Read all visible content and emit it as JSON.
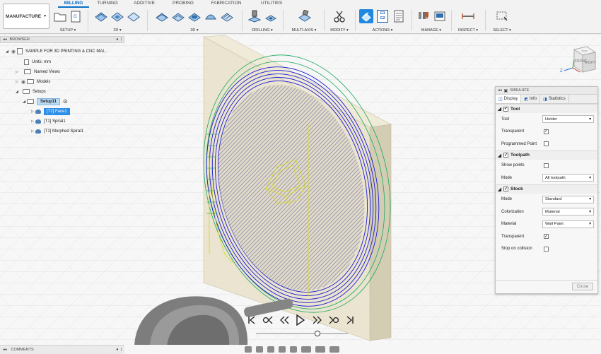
{
  "workspace": {
    "label": "MANUFACTURE"
  },
  "tabs": [
    {
      "label": "MILLING",
      "active": true
    },
    {
      "label": "TURNING"
    },
    {
      "label": "ADDITIVE"
    },
    {
      "label": "PROBING"
    },
    {
      "label": "FABRICATION"
    },
    {
      "label": "UTILITIES"
    }
  ],
  "groups": {
    "setup": "SETUP",
    "d2": "2D",
    "d3": "3D",
    "drilling": "DRILLING",
    "multiaxis": "MULTI-AXIS",
    "modify": "MODIFY",
    "actions": "ACTIONS",
    "manage": "MANAGE",
    "inspect": "INSPECT",
    "select": "SELECT"
  },
  "actions_icon_text": {
    "line1": "G1",
    "line2": "G2"
  },
  "browser": {
    "title": "BROWSER",
    "document": "SAMPLE FOR 3D PRINTING & CNC MAI...",
    "units": "Units: mm",
    "named_views": "Named Views",
    "models": "Models",
    "setups": "Setups",
    "setup_name": "Setup11",
    "operations": [
      "[T2] Face1",
      "[T1] Spiral1",
      "[T1] Morphed Spiral1"
    ]
  },
  "simulate": {
    "title": "SIMULATE",
    "tabs": [
      "Display",
      "Info",
      "Statistics"
    ],
    "tool_section": {
      "title": "Tool",
      "enabled": true,
      "tool_label": "Tool",
      "tool_value": "Holder",
      "transparent_label": "Transparent",
      "transparent_checked": true,
      "programmed_point_label": "Programmed Point",
      "programmed_point_checked": false
    },
    "toolpath_section": {
      "title": "Toolpath",
      "enabled": true,
      "show_points_label": "Show points",
      "show_points_checked": false,
      "mode_label": "Mode",
      "mode_value": "All toolpath"
    },
    "stock_section": {
      "title": "Stock",
      "enabled": true,
      "mode_label": "Mode",
      "mode_value": "Standard",
      "colorization_label": "Colorization",
      "colorization_value": "Material",
      "material_label": "Material",
      "material_value": "Wall Paint",
      "transparent_label": "Transparent",
      "transparent_checked": true,
      "stop_on_collision_label": "Stop on collision",
      "stop_on_collision_checked": false
    },
    "close_label": "Close"
  },
  "viewcube": {
    "front": "FRONT",
    "right": "RIGHT",
    "top": "TOP"
  },
  "comments": {
    "title": "COMMENTS"
  },
  "playback": {
    "progress": 0.68
  },
  "colors": {
    "accent": "#0a6ec8",
    "toolpath_blue": "#1a1ad6",
    "toolpath_green": "#17a85b",
    "toolpath_yellow": "#e6e62a",
    "stock": "#e7e1c9"
  }
}
